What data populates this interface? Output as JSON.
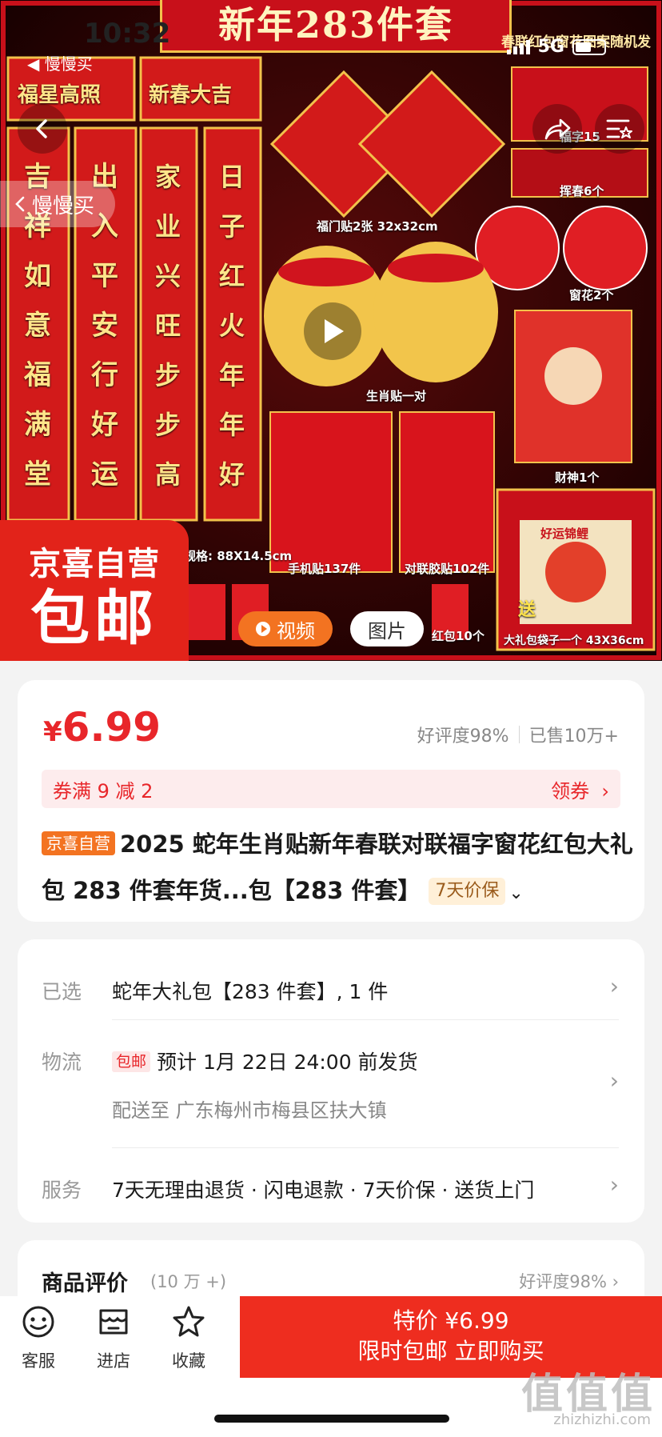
{
  "status_bar": {
    "time": "10:32",
    "back_app": "◀ 慢慢买",
    "network": "5G"
  },
  "hero": {
    "banner_title": "新年283件套",
    "banner_note": "春联红包窗花图案随机发",
    "from_pill": "慢慢买",
    "art_labels": {
      "couplet_size": "规格: 88X14.5cm",
      "fu_door": "福门贴2张 32x32cm",
      "fu_char": "福字15",
      "spring": "挥春6个",
      "window": "窗花2个",
      "zodiac": "生肖贴一对",
      "phone_sticker": "手机贴137件",
      "couplet_sticker": "对联胶贴102件",
      "god": "财神1个",
      "red_packet": "红包10个",
      "gift_bag": "大礼包袋子一个 43X36cm",
      "send": "送",
      "lucky": "好运锦鲤",
      "couplet_top": "福星高照",
      "couplet_top2": "新春大吉",
      "left_couplet": "吉祥如意福满堂",
      "left_couplet2": "出入平安行好运",
      "mid_couplet": "家业兴旺步步高",
      "mid_couplet2": "日子红火年年好"
    },
    "promo_top": "京喜自营",
    "promo_bottom": "包邮",
    "media_video": "视频",
    "media_pic": "图片"
  },
  "product": {
    "price_symbol": "¥",
    "price": "6.99",
    "rating": "好评度98%",
    "sold": "已售10万+",
    "coupon_text": "券满 9 减 2",
    "coupon_action": "领券",
    "self_tag": "京喜自营",
    "title": "2025 蛇年生肖贴新年春联对联福字窗花红包大礼包 283 件套年货...包【283 件套】",
    "guarantee_tag": "7天价保"
  },
  "info": {
    "selected_label": "已选",
    "selected_value": "蛇年大礼包【283 件套】, 1 件",
    "logistics_label": "物流",
    "logistics_tag": "包邮",
    "logistics_value": "预计 1月 22日 24:00 前发货",
    "delivery_value": "配送至 广东梅州市梅县区扶大镇",
    "service_label": "服务",
    "service_value": "7天无理由退货 · 闪电退款 · 7天价保 · 送货上门"
  },
  "reviews": {
    "title": "商品评价",
    "count": "(10 万 +)",
    "rating": "好评度98%"
  },
  "bottom_bar": {
    "service": "客服",
    "store": "进店",
    "favorite": "收藏",
    "buy_line1": "特价 ¥6.99",
    "buy_line2": "限时包邮 立即购买"
  },
  "watermark": {
    "logo": "值值值",
    "url": "zhizhizhi.com"
  },
  "colors": {
    "accent_red": "#e8262a",
    "buy_button": "#ee2d1f",
    "orange_tag": "#f37321"
  }
}
